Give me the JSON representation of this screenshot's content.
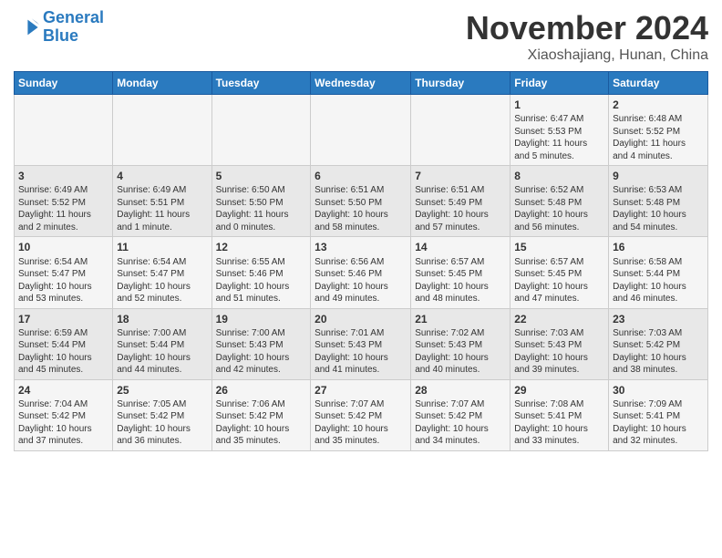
{
  "header": {
    "logo_line1": "General",
    "logo_line2": "Blue",
    "month_title": "November 2024",
    "location": "Xiaoshajiang, Hunan, China"
  },
  "weekdays": [
    "Sunday",
    "Monday",
    "Tuesday",
    "Wednesday",
    "Thursday",
    "Friday",
    "Saturday"
  ],
  "weeks": [
    [
      {
        "day": "",
        "info": ""
      },
      {
        "day": "",
        "info": ""
      },
      {
        "day": "",
        "info": ""
      },
      {
        "day": "",
        "info": ""
      },
      {
        "day": "",
        "info": ""
      },
      {
        "day": "1",
        "info": "Sunrise: 6:47 AM\nSunset: 5:53 PM\nDaylight: 11 hours\nand 5 minutes."
      },
      {
        "day": "2",
        "info": "Sunrise: 6:48 AM\nSunset: 5:52 PM\nDaylight: 11 hours\nand 4 minutes."
      }
    ],
    [
      {
        "day": "3",
        "info": "Sunrise: 6:49 AM\nSunset: 5:52 PM\nDaylight: 11 hours\nand 2 minutes."
      },
      {
        "day": "4",
        "info": "Sunrise: 6:49 AM\nSunset: 5:51 PM\nDaylight: 11 hours\nand 1 minute."
      },
      {
        "day": "5",
        "info": "Sunrise: 6:50 AM\nSunset: 5:50 PM\nDaylight: 11 hours\nand 0 minutes."
      },
      {
        "day": "6",
        "info": "Sunrise: 6:51 AM\nSunset: 5:50 PM\nDaylight: 10 hours\nand 58 minutes."
      },
      {
        "day": "7",
        "info": "Sunrise: 6:51 AM\nSunset: 5:49 PM\nDaylight: 10 hours\nand 57 minutes."
      },
      {
        "day": "8",
        "info": "Sunrise: 6:52 AM\nSunset: 5:48 PM\nDaylight: 10 hours\nand 56 minutes."
      },
      {
        "day": "9",
        "info": "Sunrise: 6:53 AM\nSunset: 5:48 PM\nDaylight: 10 hours\nand 54 minutes."
      }
    ],
    [
      {
        "day": "10",
        "info": "Sunrise: 6:54 AM\nSunset: 5:47 PM\nDaylight: 10 hours\nand 53 minutes."
      },
      {
        "day": "11",
        "info": "Sunrise: 6:54 AM\nSunset: 5:47 PM\nDaylight: 10 hours\nand 52 minutes."
      },
      {
        "day": "12",
        "info": "Sunrise: 6:55 AM\nSunset: 5:46 PM\nDaylight: 10 hours\nand 51 minutes."
      },
      {
        "day": "13",
        "info": "Sunrise: 6:56 AM\nSunset: 5:46 PM\nDaylight: 10 hours\nand 49 minutes."
      },
      {
        "day": "14",
        "info": "Sunrise: 6:57 AM\nSunset: 5:45 PM\nDaylight: 10 hours\nand 48 minutes."
      },
      {
        "day": "15",
        "info": "Sunrise: 6:57 AM\nSunset: 5:45 PM\nDaylight: 10 hours\nand 47 minutes."
      },
      {
        "day": "16",
        "info": "Sunrise: 6:58 AM\nSunset: 5:44 PM\nDaylight: 10 hours\nand 46 minutes."
      }
    ],
    [
      {
        "day": "17",
        "info": "Sunrise: 6:59 AM\nSunset: 5:44 PM\nDaylight: 10 hours\nand 45 minutes."
      },
      {
        "day": "18",
        "info": "Sunrise: 7:00 AM\nSunset: 5:44 PM\nDaylight: 10 hours\nand 44 minutes."
      },
      {
        "day": "19",
        "info": "Sunrise: 7:00 AM\nSunset: 5:43 PM\nDaylight: 10 hours\nand 42 minutes."
      },
      {
        "day": "20",
        "info": "Sunrise: 7:01 AM\nSunset: 5:43 PM\nDaylight: 10 hours\nand 41 minutes."
      },
      {
        "day": "21",
        "info": "Sunrise: 7:02 AM\nSunset: 5:43 PM\nDaylight: 10 hours\nand 40 minutes."
      },
      {
        "day": "22",
        "info": "Sunrise: 7:03 AM\nSunset: 5:43 PM\nDaylight: 10 hours\nand 39 minutes."
      },
      {
        "day": "23",
        "info": "Sunrise: 7:03 AM\nSunset: 5:42 PM\nDaylight: 10 hours\nand 38 minutes."
      }
    ],
    [
      {
        "day": "24",
        "info": "Sunrise: 7:04 AM\nSunset: 5:42 PM\nDaylight: 10 hours\nand 37 minutes."
      },
      {
        "day": "25",
        "info": "Sunrise: 7:05 AM\nSunset: 5:42 PM\nDaylight: 10 hours\nand 36 minutes."
      },
      {
        "day": "26",
        "info": "Sunrise: 7:06 AM\nSunset: 5:42 PM\nDaylight: 10 hours\nand 35 minutes."
      },
      {
        "day": "27",
        "info": "Sunrise: 7:07 AM\nSunset: 5:42 PM\nDaylight: 10 hours\nand 35 minutes."
      },
      {
        "day": "28",
        "info": "Sunrise: 7:07 AM\nSunset: 5:42 PM\nDaylight: 10 hours\nand 34 minutes."
      },
      {
        "day": "29",
        "info": "Sunrise: 7:08 AM\nSunset: 5:41 PM\nDaylight: 10 hours\nand 33 minutes."
      },
      {
        "day": "30",
        "info": "Sunrise: 7:09 AM\nSunset: 5:41 PM\nDaylight: 10 hours\nand 32 minutes."
      }
    ]
  ]
}
